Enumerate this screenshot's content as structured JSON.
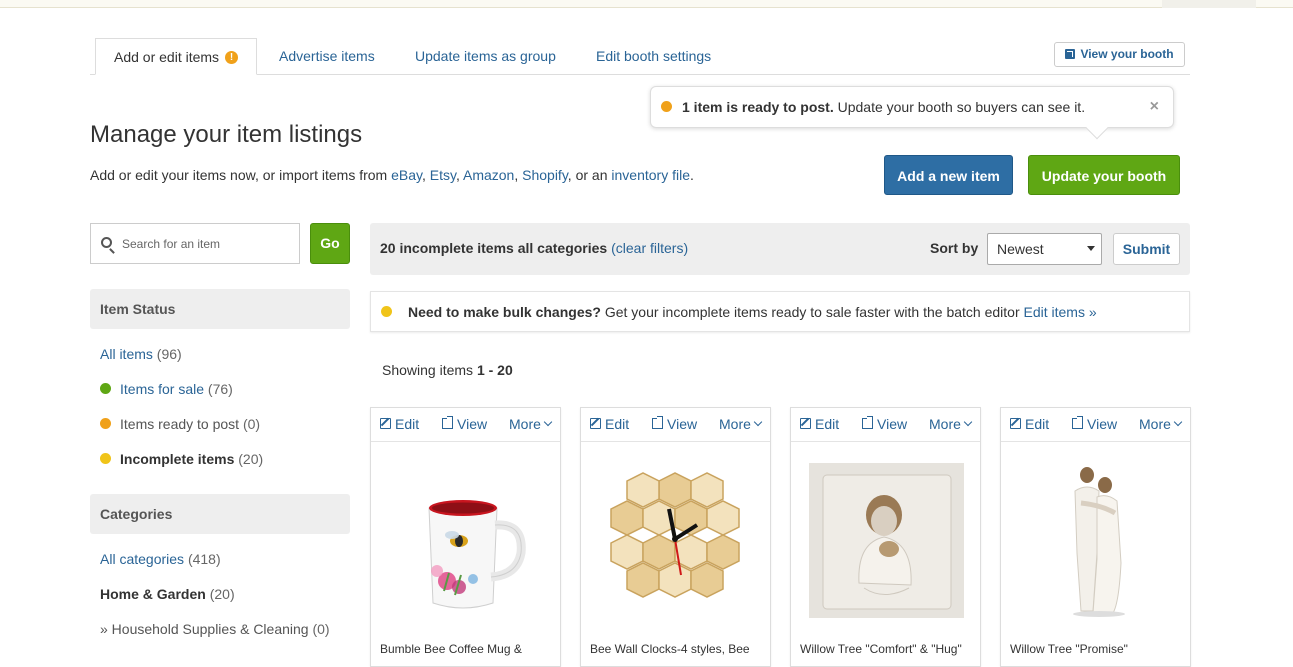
{
  "tabs": [
    {
      "label": "Add or edit items",
      "alert": "!"
    },
    {
      "label": "Advertise items"
    },
    {
      "label": "Update items as group"
    },
    {
      "label": "Edit booth settings"
    }
  ],
  "view_booth_label": "View your booth",
  "notice": {
    "bold": "1 item is ready to post.",
    "text": " Update your booth so buyers can see it.",
    "close": "×"
  },
  "page_title": "Manage your item listings",
  "subtitle": {
    "prefix": "Add or edit your items now, or import items from ",
    "links": [
      "eBay",
      "Etsy",
      "Amazon",
      "Shopify"
    ],
    "mid": ", or an ",
    "file_link": "inventory file",
    "suffix": "."
  },
  "buttons": {
    "add_item": "Add a new item",
    "update_booth": "Update your booth"
  },
  "search": {
    "placeholder": "Search for an item",
    "value": "",
    "go": "Go"
  },
  "item_status": {
    "heading": "Item Status",
    "items": [
      {
        "label": "All items",
        "count": "(96)",
        "color": ""
      },
      {
        "label": "Items for sale",
        "count": "(76)",
        "color": "#5fa714"
      },
      {
        "label": "Items ready to post",
        "count": "(0)",
        "color": "#f0a11a"
      },
      {
        "label": "Incomplete items",
        "count": "(20)",
        "color": "#f0c419"
      }
    ]
  },
  "categories": {
    "heading": "Categories",
    "all": {
      "label": "All categories",
      "count": "(418)"
    },
    "current": {
      "label": "Home & Garden",
      "count": "(20)"
    },
    "sub": {
      "label": "» Household Supplies & Cleaning",
      "count": "(0)"
    }
  },
  "filter_bar": {
    "summary": "20 incomplete items all categories",
    "clear": "(clear filters)",
    "sort_label": "Sort by",
    "sort_value": "Newest",
    "submit": "Submit"
  },
  "bulk": {
    "bold": "Need to make bulk changes?",
    "text": " Get your incomplete items ready to sale faster with the batch editor ",
    "link": "Edit items »",
    "dot_color": "#f0c419"
  },
  "showing": {
    "prefix": "Showing items ",
    "range": "1 - 20"
  },
  "card_actions": {
    "edit": "Edit",
    "view": "View",
    "more": "More"
  },
  "cards": [
    {
      "title": "Bumble Bee Coffee Mug &"
    },
    {
      "title": "Bee Wall Clocks-4 styles, Bee"
    },
    {
      "title": "Willow Tree \"Comfort\" & \"Hug\""
    },
    {
      "title": "Willow Tree \"Promise\""
    }
  ]
}
